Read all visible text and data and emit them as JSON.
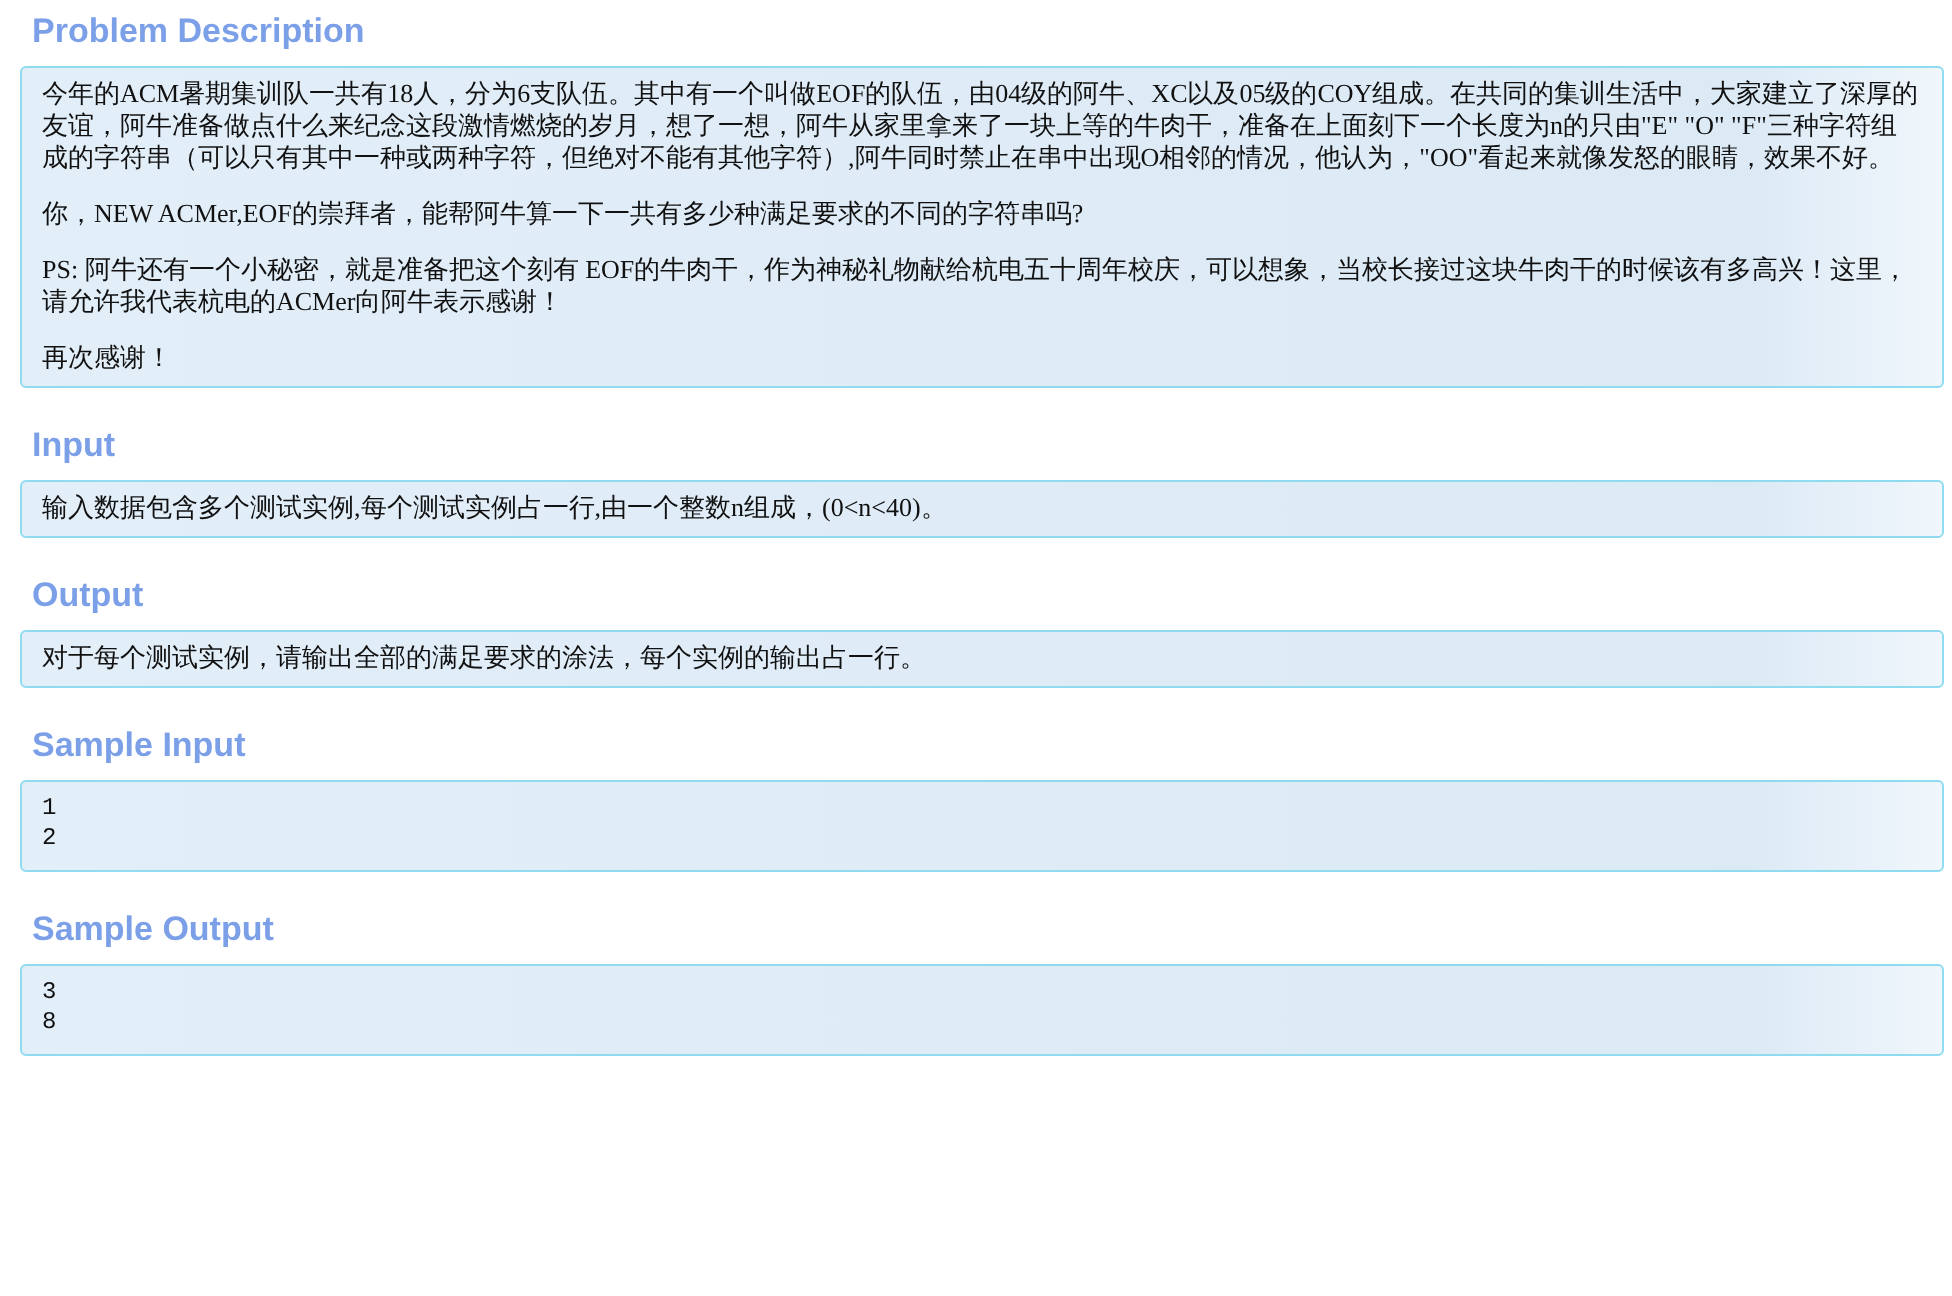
{
  "sections": [
    {
      "title": "Problem Description",
      "kind": "text",
      "paragraphs": [
        "今年的ACM暑期集训队一共有18人，分为6支队伍。其中有一个叫做EOF的队伍，由04级的阿牛、XC以及05级的COY组成。在共同的集训生活中，大家建立了深厚的友谊，阿牛准备做点什么来纪念这段激情燃烧的岁月，想了一想，阿牛从家里拿来了一块上等的牛肉干，准备在上面刻下一个长度为n的只由\"E\" \"O\" \"F\"三种字符组成的字符串（可以只有其中一种或两种字符，但绝对不能有其他字符）,阿牛同时禁止在串中出现O相邻的情况，他认为，\"OO\"看起来就像发怒的眼睛，效果不好。",
        "你，NEW ACMer,EOF的崇拜者，能帮阿牛算一下一共有多少种满足要求的不同的字符串吗?",
        "PS: 阿牛还有一个小秘密，就是准备把这个刻有 EOF的牛肉干，作为神秘礼物献给杭电五十周年校庆，可以想象，当校长接过这块牛肉干的时候该有多高兴！这里，请允许我代表杭电的ACMer向阿牛表示感谢！",
        "再次感谢！"
      ]
    },
    {
      "title": "Input",
      "kind": "text",
      "paragraphs": [
        "输入数据包含多个测试实例,每个测试实例占一行,由一个整数n组成，(0<n<40)。"
      ]
    },
    {
      "title": "Output",
      "kind": "text",
      "paragraphs": [
        "对于每个测试实例，请输出全部的满足要求的涂法，每个实例的输出占一行。"
      ]
    },
    {
      "title": "Sample Input",
      "kind": "code",
      "paragraphs": [
        "1",
        "2"
      ]
    },
    {
      "title": "Sample Output",
      "kind": "code",
      "paragraphs": [
        "3",
        "8"
      ]
    }
  ]
}
